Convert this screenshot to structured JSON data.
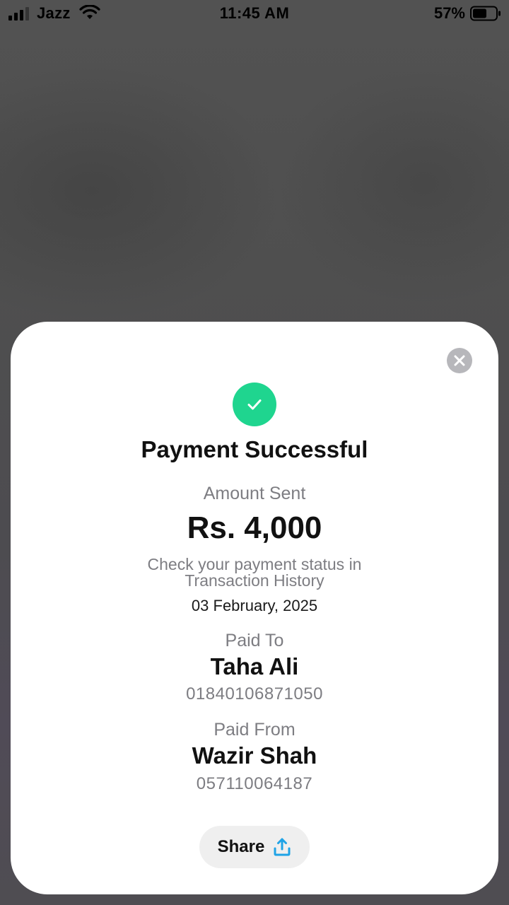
{
  "status_bar": {
    "carrier": "Jazz",
    "time": "11:45 AM",
    "battery_percent": "57%",
    "signal_icon": "signal-bars-icon",
    "wifi_icon": "wifi-icon",
    "battery_icon": "battery-icon"
  },
  "sheet": {
    "close_icon": "close-icon",
    "success_icon": "checkmark-icon",
    "title": "Payment Successful",
    "amount_label": "Amount Sent",
    "amount": "Rs. 4,000",
    "status_note_line1": "Check your payment status in",
    "status_note_line2": "Transaction History",
    "date": "03 February, 2025",
    "paid_to": {
      "label": "Paid To",
      "name": "Taha Ali",
      "number": "01840106871050"
    },
    "paid_from": {
      "label": "Paid From",
      "name": "Wazir Shah",
      "number": "057110064187"
    },
    "share": {
      "label": "Share",
      "icon": "share-upload-icon"
    }
  },
  "colors": {
    "success_green": "#1fd58f",
    "share_icon_blue": "#1fa3e6",
    "muted_text": "#7d7d82",
    "overlay": "#4f4f4f"
  }
}
